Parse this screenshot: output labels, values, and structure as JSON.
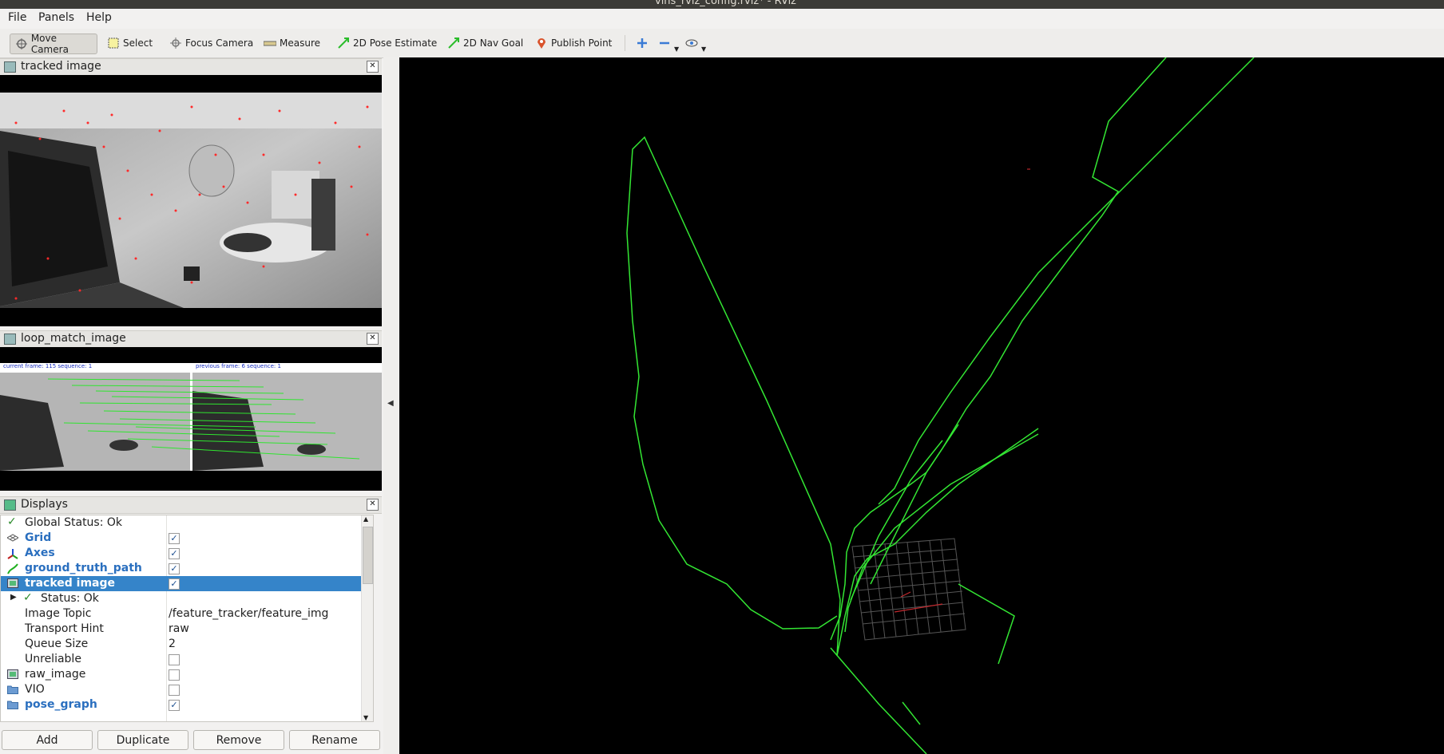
{
  "window": {
    "title": "vins_rviz_config.rviz* - RViz"
  },
  "menu": [
    {
      "label": "File"
    },
    {
      "label": "Panels"
    },
    {
      "label": "Help"
    }
  ],
  "toolbar": {
    "move_camera": "Move Camera",
    "select": "Select",
    "focus_camera": "Focus Camera",
    "measure": "Measure",
    "pose_estimate": "2D Pose Estimate",
    "nav_goal": "2D Nav Goal",
    "publish_point": "Publish Point"
  },
  "panels": {
    "tracked_image": {
      "title": "tracked image"
    },
    "loop_match": {
      "title": "loop_match_image",
      "left_caption": "current frame: 115  sequence: 1",
      "right_caption": "previous frame: 6  sequence: 1"
    },
    "displays": {
      "title": "Displays"
    }
  },
  "displays": {
    "global_status": "Global Status: Ok",
    "grid": "Grid",
    "axes": "Axes",
    "ground_truth": "ground_truth_path",
    "tracked_image": "tracked image",
    "status": "Status: Ok",
    "image_topic_label": "Image Topic",
    "image_topic_value": "/feature_tracker/feature_img",
    "transport_label": "Transport Hint",
    "transport_value": "raw",
    "queue_label": "Queue Size",
    "queue_value": "2",
    "unreliable_label": "Unreliable",
    "raw_image": "raw_image",
    "vio": "VIO",
    "pose_graph": "pose_graph",
    "checks": {
      "grid": true,
      "axes": true,
      "ground_truth": true,
      "tracked_image": true,
      "unreliable": false,
      "raw_image": false,
      "vio": false,
      "pose_graph": true
    }
  },
  "buttons": {
    "add": "Add",
    "duplicate": "Duplicate",
    "remove": "Remove",
    "rename": "Rename"
  },
  "colors": {
    "path": "#33e633",
    "selection": "#3584c9"
  }
}
